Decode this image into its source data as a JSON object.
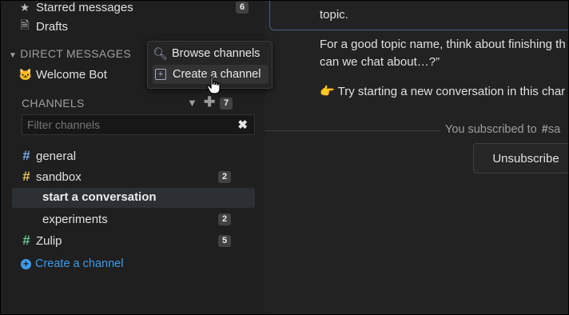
{
  "sidebar": {
    "starred_messages": {
      "label": "Starred messages",
      "count": "6"
    },
    "drafts": {
      "label": "Drafts"
    },
    "direct_messages": {
      "header": "DIRECT MESSAGES",
      "items": [
        {
          "label": "Welcome Bot"
        }
      ]
    },
    "channels": {
      "header": "CHANNELS",
      "count": "7",
      "filter_placeholder": "Filter channels",
      "items": [
        {
          "label": "general",
          "color": "#76a9e0",
          "count": ""
        },
        {
          "label": "sandbox",
          "color": "#e4c55a",
          "count": "2"
        },
        {
          "label": "start a conversation",
          "count": ""
        },
        {
          "label": "experiments",
          "count": "2"
        },
        {
          "label": "Zulip",
          "color": "#68c48f",
          "count": "5"
        }
      ],
      "create_link": "Create a channel"
    }
  },
  "popover": {
    "browse_label": "Browse channels",
    "create_label": "Create a channel"
  },
  "message": {
    "line1": "topic.",
    "line2": "For a good topic name, think about finishing th",
    "line3": "can we chat about…?”",
    "line4_emoji": "👉",
    "line4": "Try starting a new conversation in this char"
  },
  "subscription": {
    "notice": "You subscribed to",
    "channel_fragment": "sa",
    "unsubscribe_label": "Unsubscribe"
  },
  "colors": {
    "link": "#3d9be9",
    "general": "#76a9e0",
    "sandbox": "#e4c55a",
    "zulip": "#68c48f"
  }
}
